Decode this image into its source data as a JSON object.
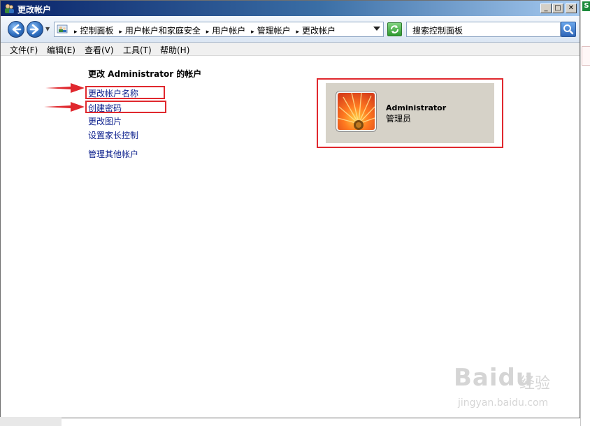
{
  "window": {
    "title": "更改帐户"
  },
  "window_controls": {
    "minimize": "_",
    "maximize": "□",
    "close": "✕"
  },
  "navigation": {
    "breadcrumbs": [
      "控制面板",
      "用户帐户和家庭安全",
      "用户帐户",
      "管理帐户",
      "更改帐户"
    ],
    "search_placeholder": "搜索控制面板"
  },
  "menu": [
    "文件(F)",
    "编辑(E)",
    "查看(V)",
    "工具(T)",
    "帮助(H)"
  ],
  "content": {
    "heading": "更改 Administrator 的帐户",
    "links": [
      "更改帐户名称",
      "创建密码",
      "更改图片",
      "设置家长控制"
    ],
    "other_link": "管理其他帐户"
  },
  "account": {
    "name": "Administrator",
    "role": "管理员"
  },
  "annotation": {
    "color": "#e0282e"
  },
  "watermark": {
    "logo": "Baidu",
    "brand": "经验",
    "url": "jingyan.baidu.com"
  }
}
